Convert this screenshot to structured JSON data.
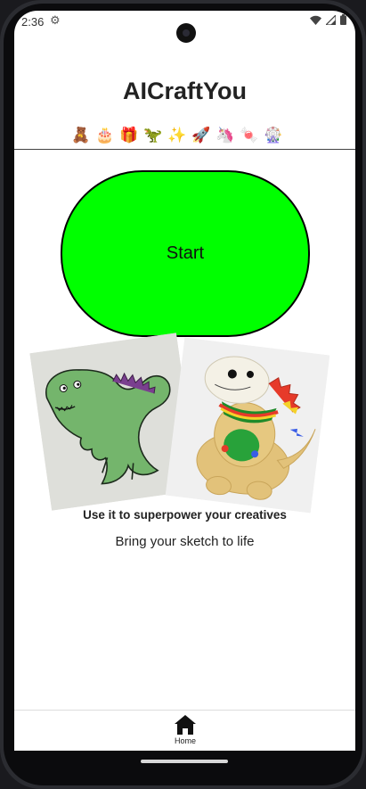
{
  "status_bar": {
    "time": "2:36",
    "settings_icon": "gear-icon",
    "wifi_icon": "wifi-icon",
    "signal_icon": "signal-icon",
    "battery_icon": "battery-icon"
  },
  "app": {
    "title": "AICraftYou",
    "emojis": [
      "🧸",
      "🎂",
      "🎁",
      "🦖",
      "✨",
      "🚀",
      "🦄",
      "🍬",
      "🎡"
    ]
  },
  "main": {
    "start_label": "Start",
    "start_color": "#00ff00",
    "left_image": "watercolor-dinosaur-drawing",
    "right_image": "plush-dinosaur-toy",
    "headline": "Use it to superpower your creatives",
    "subline": "Bring your sketch to life"
  },
  "bottom_nav": {
    "home_label": "Home",
    "home_icon": "home-icon"
  }
}
